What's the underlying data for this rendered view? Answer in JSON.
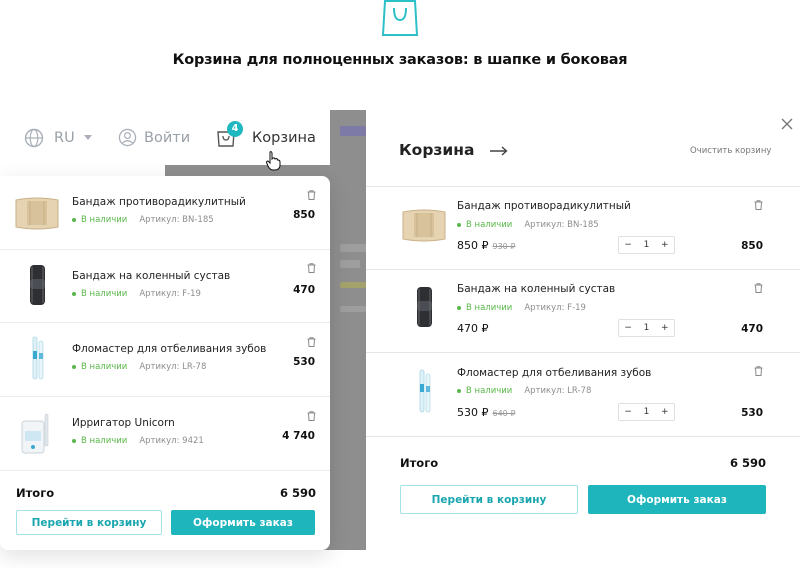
{
  "hero": {
    "title": "Корзина для полноценных заказов: в шапке и боковая"
  },
  "header": {
    "language": "RU",
    "login_label": "Войти",
    "cart_label": "Корзина",
    "cart_count": "4"
  },
  "dropdown_cart": {
    "items": [
      {
        "name": "Бандаж противорадикулитный",
        "stock": "В наличии",
        "sku": "Артикул: BN-185",
        "price": "850",
        "thumb_icon": "belt-bandage-icon"
      },
      {
        "name": "Бандаж на коленный сустав",
        "stock": "В наличии",
        "sku": "Артикул: F-19",
        "price": "470",
        "thumb_icon": "knee-brace-icon"
      },
      {
        "name": "Фломастер для отбеливания зубов",
        "stock": "В наличии",
        "sku": "Артикул: LR-78",
        "price": "530",
        "thumb_icon": "whitening-pen-icon"
      },
      {
        "name": "Ирригатор Unicorn",
        "stock": "В наличии",
        "sku": "Артикул: 9421",
        "price": "4 740",
        "thumb_icon": "irrigator-icon"
      }
    ],
    "total_label": "Итого",
    "total_value": "6 590",
    "go_to_cart": "Перейти в корзину",
    "checkout": "Оформить заказ"
  },
  "side_cart": {
    "title": "Корзина",
    "clear_label": "Очистить корзину",
    "items": [
      {
        "name": "Бандаж противорадикулитный",
        "stock": "В наличии",
        "sku": "Артикул: BN-185",
        "price": "850 ₽",
        "old_price": "930 ₽",
        "qty": "1",
        "sum": "850"
      },
      {
        "name": "Бандаж на коленный сустав",
        "stock": "В наличии",
        "sku": "Артикул: F-19",
        "price": "470 ₽",
        "old_price": "",
        "qty": "1",
        "sum": "470"
      },
      {
        "name": "Фломастер для отбеливания зубов",
        "stock": "В наличии",
        "sku": "Артикул: LR-78",
        "price": "530 ₽",
        "old_price": "640 ₽",
        "qty": "1",
        "sum": "530"
      }
    ],
    "minus": "−",
    "plus": "+",
    "total_label": "Итого",
    "total_value": "6 590",
    "go_to_cart": "Перейти в корзину",
    "checkout": "Оформить заказ"
  },
  "colors": {
    "accent": "#1eb5bd",
    "in_stock": "#59b84a",
    "overlay": "#8e8e8e"
  }
}
